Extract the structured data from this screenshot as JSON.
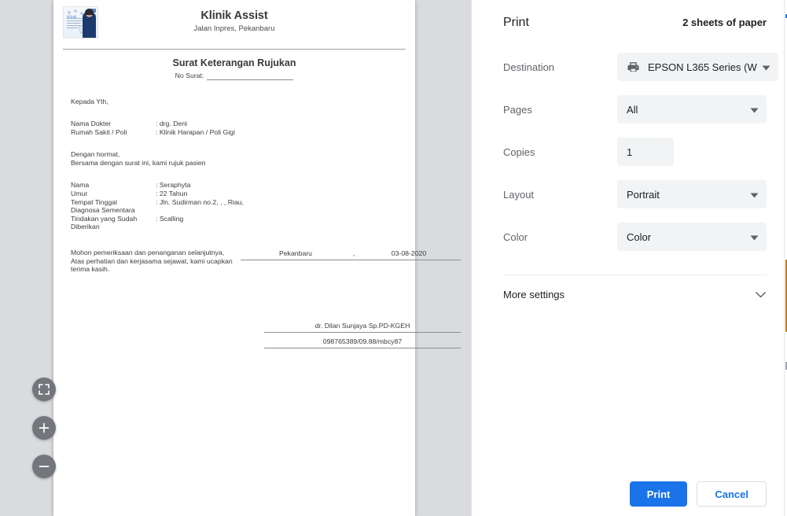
{
  "preview": {
    "zoom_controls": [
      {
        "name": "fit-to-page",
        "glyph": "fullscreen-icon"
      },
      {
        "name": "zoom-in",
        "glyph": "plus-icon"
      },
      {
        "name": "zoom-out",
        "glyph": "minus-icon"
      }
    ]
  },
  "document": {
    "clinic_name": "Klinik Assist",
    "clinic_address": "Jalan Inpres, Pekanbaru",
    "title": "Surat Keterangan Rujukan",
    "no_surat_label": "No Surat:",
    "no_surat_value": "",
    "kepada": "Kepada Yth,",
    "doctor_rows": [
      {
        "key": "Nama Dokter",
        "value": ": drg. Deni"
      },
      {
        "key": "Rumah Sakit / Poli",
        "value": ": Klinik Harapan / Poli Gigi"
      }
    ],
    "salutation_line1": "Dengan hormat,",
    "salutation_line2": "Bersama dengan surat ini, kami rujuk pasien",
    "patient_rows": [
      {
        "key": "Nama",
        "value": ": Seraphyta"
      },
      {
        "key": "Umur",
        "value": ": 22 Tahun"
      },
      {
        "key": "Tempat Tinggal",
        "value": ": Jln. Sudirman no.2, , , Riau,"
      },
      {
        "key": "Diagnosa Sementara",
        "value": ""
      },
      {
        "key": "Tindakan yang Sudah",
        "value": ": Scalling"
      },
      {
        "key": "Diberikan",
        "value": ""
      }
    ],
    "closing_line1": "Mohon pemeriksaan dan penanganan selanjutnya,",
    "closing_line2": "Atas perhatian dan kerjasama sejawat, kami ucapkan",
    "closing_line3": "terima kasih.",
    "place": "Pekanbaru",
    "place_date_separator": ",",
    "date": "03-08-2020",
    "signer_name": "dr. Dilan Sunjaya Sp.PD-KGEH",
    "signer_id": "098765389/09.88/mbcy87"
  },
  "print_dialog": {
    "title": "Print",
    "sheets_summary": "2 sheets of paper",
    "fields": {
      "destination": {
        "label": "Destination",
        "value": "EPSON L365 Series (W",
        "icon": "printer-icon"
      },
      "pages": {
        "label": "Pages",
        "value": "All"
      },
      "copies": {
        "label": "Copies",
        "value": "1"
      },
      "layout": {
        "label": "Layout",
        "value": "Portrait"
      },
      "color": {
        "label": "Color",
        "value": "Color"
      }
    },
    "more_settings_label": "More settings",
    "print_button": "Print",
    "cancel_button": "Cancel"
  },
  "colors": {
    "accent": "#1a73e8",
    "control_bg": "#f1f3f4",
    "preview_bg": "#d9dbde",
    "label_text": "#5f6368"
  }
}
